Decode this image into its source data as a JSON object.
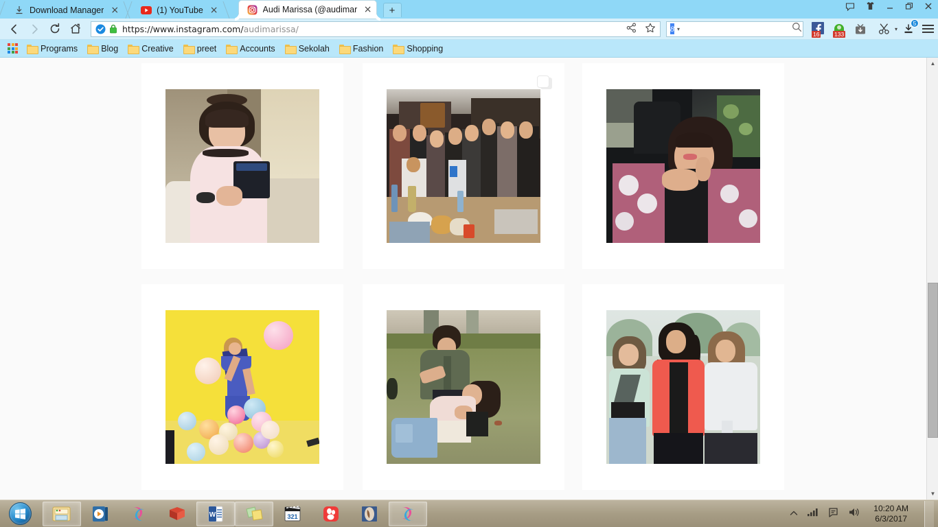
{
  "window": {
    "controls": [
      {
        "name": "feedback-icon",
        "glyph": "⬭"
      },
      {
        "name": "theme-shirt-icon",
        "glyph": "☁"
      },
      {
        "name": "minimize-button",
        "glyph": "—"
      },
      {
        "name": "restore-button",
        "glyph": "❐"
      },
      {
        "name": "close-button",
        "glyph": "✕"
      }
    ]
  },
  "tabs": [
    {
      "title": "Download Manager",
      "icon": "download-manager-icon",
      "active": false,
      "close": "×"
    },
    {
      "title": "(1) YouTube",
      "icon": "youtube-icon",
      "active": false,
      "close": "×"
    },
    {
      "title": "Audi Marissa (@audimaris",
      "icon": "instagram-icon",
      "active": true,
      "close": "×"
    }
  ],
  "new_tab_label": "+",
  "navigation": {
    "back_glyph": "‹",
    "forward_glyph": "›",
    "reload_glyph": "⟳",
    "home_glyph": "⌂",
    "url_scheme": "https://www.instagram.com/",
    "url_path": "audimarissa/",
    "share_glyph": "⪥",
    "bookmark_glyph": "☆",
    "security_badge": "verified-ssl"
  },
  "search": {
    "engine_letter": "8",
    "dropdown_glyph": "▾",
    "value": "",
    "placeholder": "",
    "search_glyph": "⌕"
  },
  "extensions": [
    {
      "name": "facebook-notifications-icon",
      "count": "16",
      "color": "#3b5998"
    },
    {
      "name": "whatsapp-notifications-icon",
      "count": "133",
      "color": "#43b02a"
    },
    {
      "name": "video-downloader-icon",
      "count": "",
      "color": "#6e6e6e"
    },
    {
      "name": "snip-tool-icon",
      "count": "",
      "color": "#3a3a3a"
    },
    {
      "name": "download-icon",
      "count": "5",
      "color": "#2b2b2b"
    }
  ],
  "menu_glyph": "≡",
  "bookmarks": {
    "apps_icon": "apps-grid-icon",
    "items": [
      {
        "label": "Programs"
      },
      {
        "label": "Blog"
      },
      {
        "label": "Creative"
      },
      {
        "label": "preet"
      },
      {
        "label": "Accounts"
      },
      {
        "label": "Sekolah"
      },
      {
        "label": "Fashion"
      },
      {
        "label": "Shopping"
      }
    ]
  },
  "page": {
    "site": "instagram",
    "profile_handle": "audimarissa",
    "background": "#fafafa",
    "card_background": "#ffffff",
    "posts": [
      {
        "id": "post-1",
        "alt": "Woman in pink top holding phone in bedroom",
        "multi": false
      },
      {
        "id": "post-2",
        "alt": "Large group of friends posing at a dinner party",
        "multi": true
      },
      {
        "id": "post-3",
        "alt": "Smiling woman in floral pink jacket inside a car",
        "multi": false
      },
      {
        "id": "post-4",
        "alt": "Woman in blue dress with colorful balloons on yellow backdrop",
        "multi": false
      },
      {
        "id": "post-5",
        "alt": "Man and woman wrestling playfully on grass",
        "multi": false
      },
      {
        "id": "post-6",
        "alt": "Three women standing outdoors, one in red puffer vest",
        "multi": false
      }
    ]
  },
  "scrollbar": {
    "up_glyph": "▲",
    "down_glyph": "▼",
    "thumb_top_pct": 51,
    "thumb_height_pct": 35
  },
  "taskbar": {
    "start_label": "start-orb",
    "items": [
      {
        "name": "file-explorer",
        "open": true
      },
      {
        "name": "media-player",
        "open": false
      },
      {
        "name": "browser-maxthon",
        "open": false
      },
      {
        "name": "dictionary-book",
        "open": false
      },
      {
        "name": "microsoft-word",
        "open": true
      },
      {
        "name": "sticky-notes",
        "open": true
      },
      {
        "name": "k-lite-codec-321",
        "open": false
      },
      {
        "name": "gom-player",
        "open": false
      },
      {
        "name": "photo-viewer",
        "open": false
      },
      {
        "name": "browser-maxthon-window",
        "open": true
      }
    ],
    "tray": [
      {
        "name": "show-hidden-icons",
        "glyph": "▲"
      },
      {
        "name": "network-signal-icon",
        "glyph": "signal"
      },
      {
        "name": "action-center-icon",
        "glyph": "flag"
      },
      {
        "name": "volume-icon",
        "glyph": "speaker"
      }
    ],
    "clock_time": "10:20 AM",
    "clock_date": "6/3/2017"
  }
}
